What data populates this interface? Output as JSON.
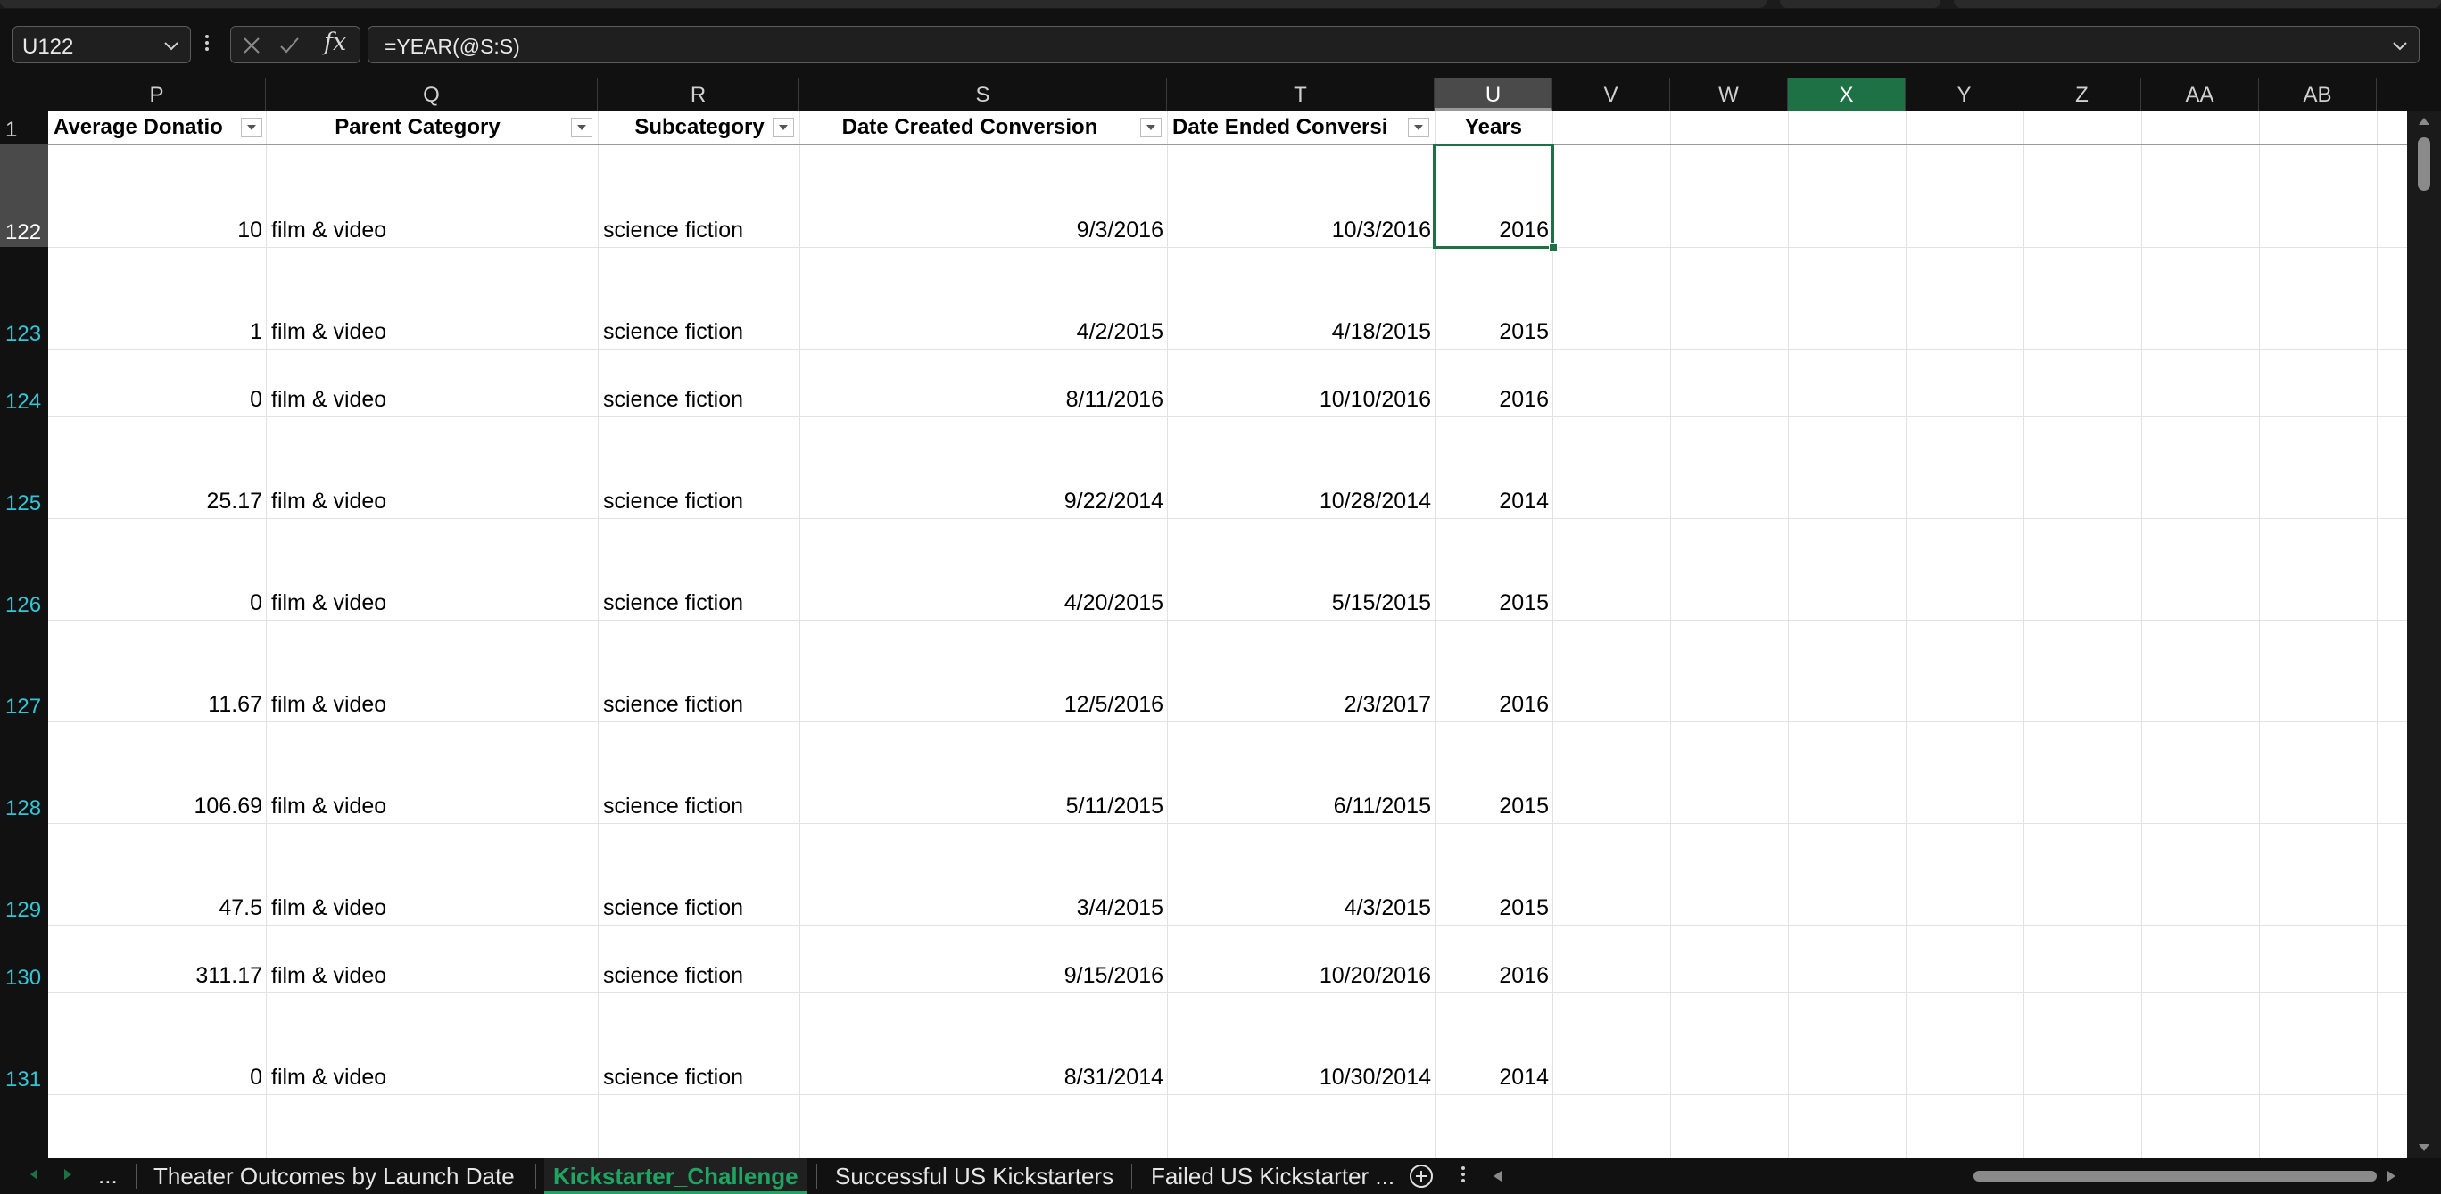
{
  "formula_bar": {
    "name_box": "U122",
    "formula": "=YEAR(@S:S)",
    "fx_label": "fx"
  },
  "column_headers": [
    "P",
    "Q",
    "R",
    "S",
    "T",
    "U",
    "V",
    "W",
    "X",
    "Y",
    "Z",
    "AA",
    "AB"
  ],
  "header_row_number": "1",
  "table_headers": {
    "average_donation": "Average Donatio",
    "parent_category": "Parent Category",
    "subcategory": "Subcategory",
    "date_created": "Date Created Conversion",
    "date_ended": "Date Ended Conversi",
    "years": "Years"
  },
  "rows": [
    {
      "row": "122",
      "avg": "10",
      "parent": "film & video",
      "sub": "science fiction",
      "created": "9/3/2016",
      "ended": "10/3/2016",
      "year": "2016"
    },
    {
      "row": "123",
      "avg": "1",
      "parent": "film & video",
      "sub": "science fiction",
      "created": "4/2/2015",
      "ended": "4/18/2015",
      "year": "2015"
    },
    {
      "row": "124",
      "avg": "0",
      "parent": "film & video",
      "sub": "science fiction",
      "created": "8/11/2016",
      "ended": "10/10/2016",
      "year": "2016"
    },
    {
      "row": "125",
      "avg": "25.17",
      "parent": "film & video",
      "sub": "science fiction",
      "created": "9/22/2014",
      "ended": "10/28/2014",
      "year": "2014"
    },
    {
      "row": "126",
      "avg": "0",
      "parent": "film & video",
      "sub": "science fiction",
      "created": "4/20/2015",
      "ended": "5/15/2015",
      "year": "2015"
    },
    {
      "row": "127",
      "avg": "11.67",
      "parent": "film & video",
      "sub": "science fiction",
      "created": "12/5/2016",
      "ended": "2/3/2017",
      "year": "2016"
    },
    {
      "row": "128",
      "avg": "106.69",
      "parent": "film & video",
      "sub": "science fiction",
      "created": "5/11/2015",
      "ended": "6/11/2015",
      "year": "2015"
    },
    {
      "row": "129",
      "avg": "47.5",
      "parent": "film & video",
      "sub": "science fiction",
      "created": "3/4/2015",
      "ended": "4/3/2015",
      "year": "2015"
    },
    {
      "row": "130",
      "avg": "311.17",
      "parent": "film & video",
      "sub": "science fiction",
      "created": "9/15/2016",
      "ended": "10/20/2016",
      "year": "2016"
    },
    {
      "row": "131",
      "avg": "0",
      "parent": "film & video",
      "sub": "science fiction",
      "created": "8/31/2014",
      "ended": "10/30/2014",
      "year": "2014"
    }
  ],
  "sheet_tabs": {
    "overflow": "...",
    "tabs": [
      "Theater Outcomes by Launch Date",
      "Kickstarter_Challenge",
      "Successful US Kickstarters",
      "Failed US Kickstarter ..."
    ],
    "active": "Kickstarter_Challenge"
  },
  "colors": {
    "accent_green": "#1e7145",
    "active_tab_text": "#1fa463",
    "row_number_cyan": "#32c5d6",
    "background_dark": "#111111"
  }
}
